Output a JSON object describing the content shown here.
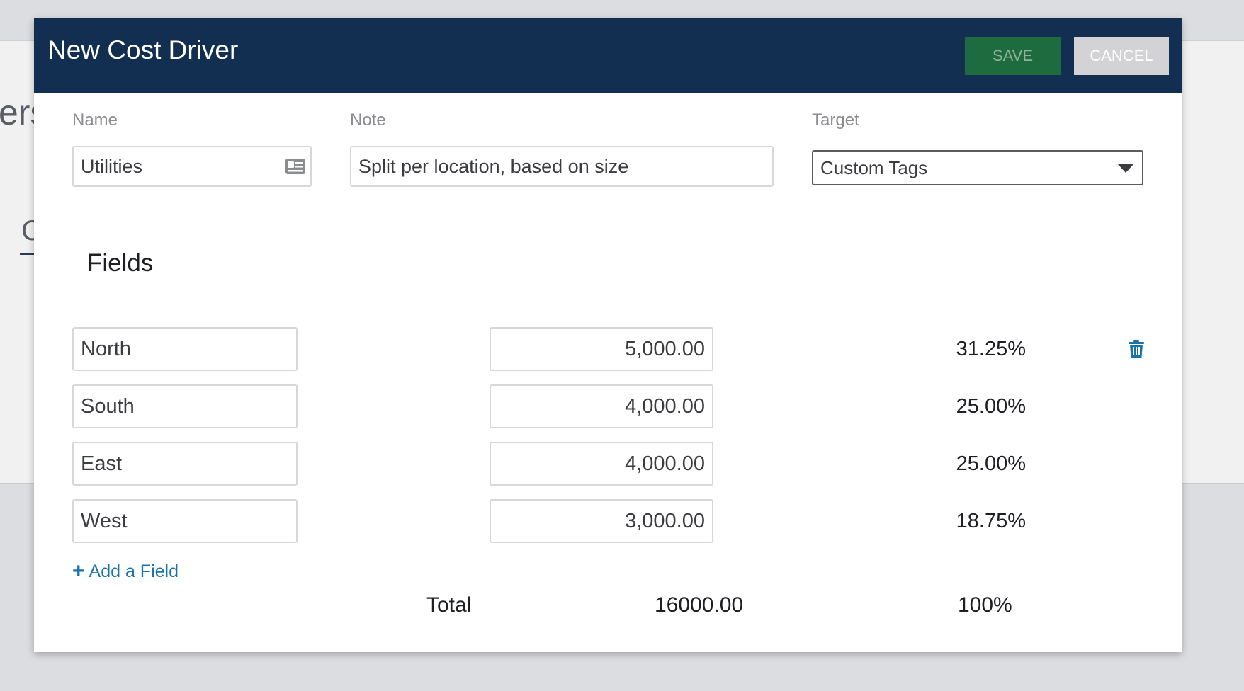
{
  "modal": {
    "title": "New Cost Driver",
    "save_label": "SAVE",
    "cancel_label": "CANCEL"
  },
  "form": {
    "name_label": "Name",
    "name_value": "Utilities",
    "note_label": "Note",
    "note_value": "Split per location, based on size",
    "target_label": "Target",
    "target_value": "Custom Tags"
  },
  "fields": {
    "title": "Fields",
    "rows": [
      {
        "name": "North",
        "value": "5,000.00",
        "percent": "31.25%"
      },
      {
        "name": "South",
        "value": "4,000.00",
        "percent": "25.00%"
      },
      {
        "name": "East",
        "value": "4,000.00",
        "percent": "25.00%"
      },
      {
        "name": "West",
        "value": "3,000.00",
        "percent": "18.75%"
      }
    ],
    "add_label": "Add a Field",
    "total_label": "Total",
    "total_value": "16000.00",
    "total_percent": "100%"
  },
  "colors": {
    "header_bg": "#122f52",
    "save_bg": "#1f6b40",
    "cancel_bg": "#d3d3d5",
    "link": "#1a73a8"
  },
  "icons": {
    "name_field_icon": "contact-card-icon",
    "delete_icon": "trash-icon",
    "add_icon": "plus-icon",
    "select_icon": "caret-down-icon"
  }
}
